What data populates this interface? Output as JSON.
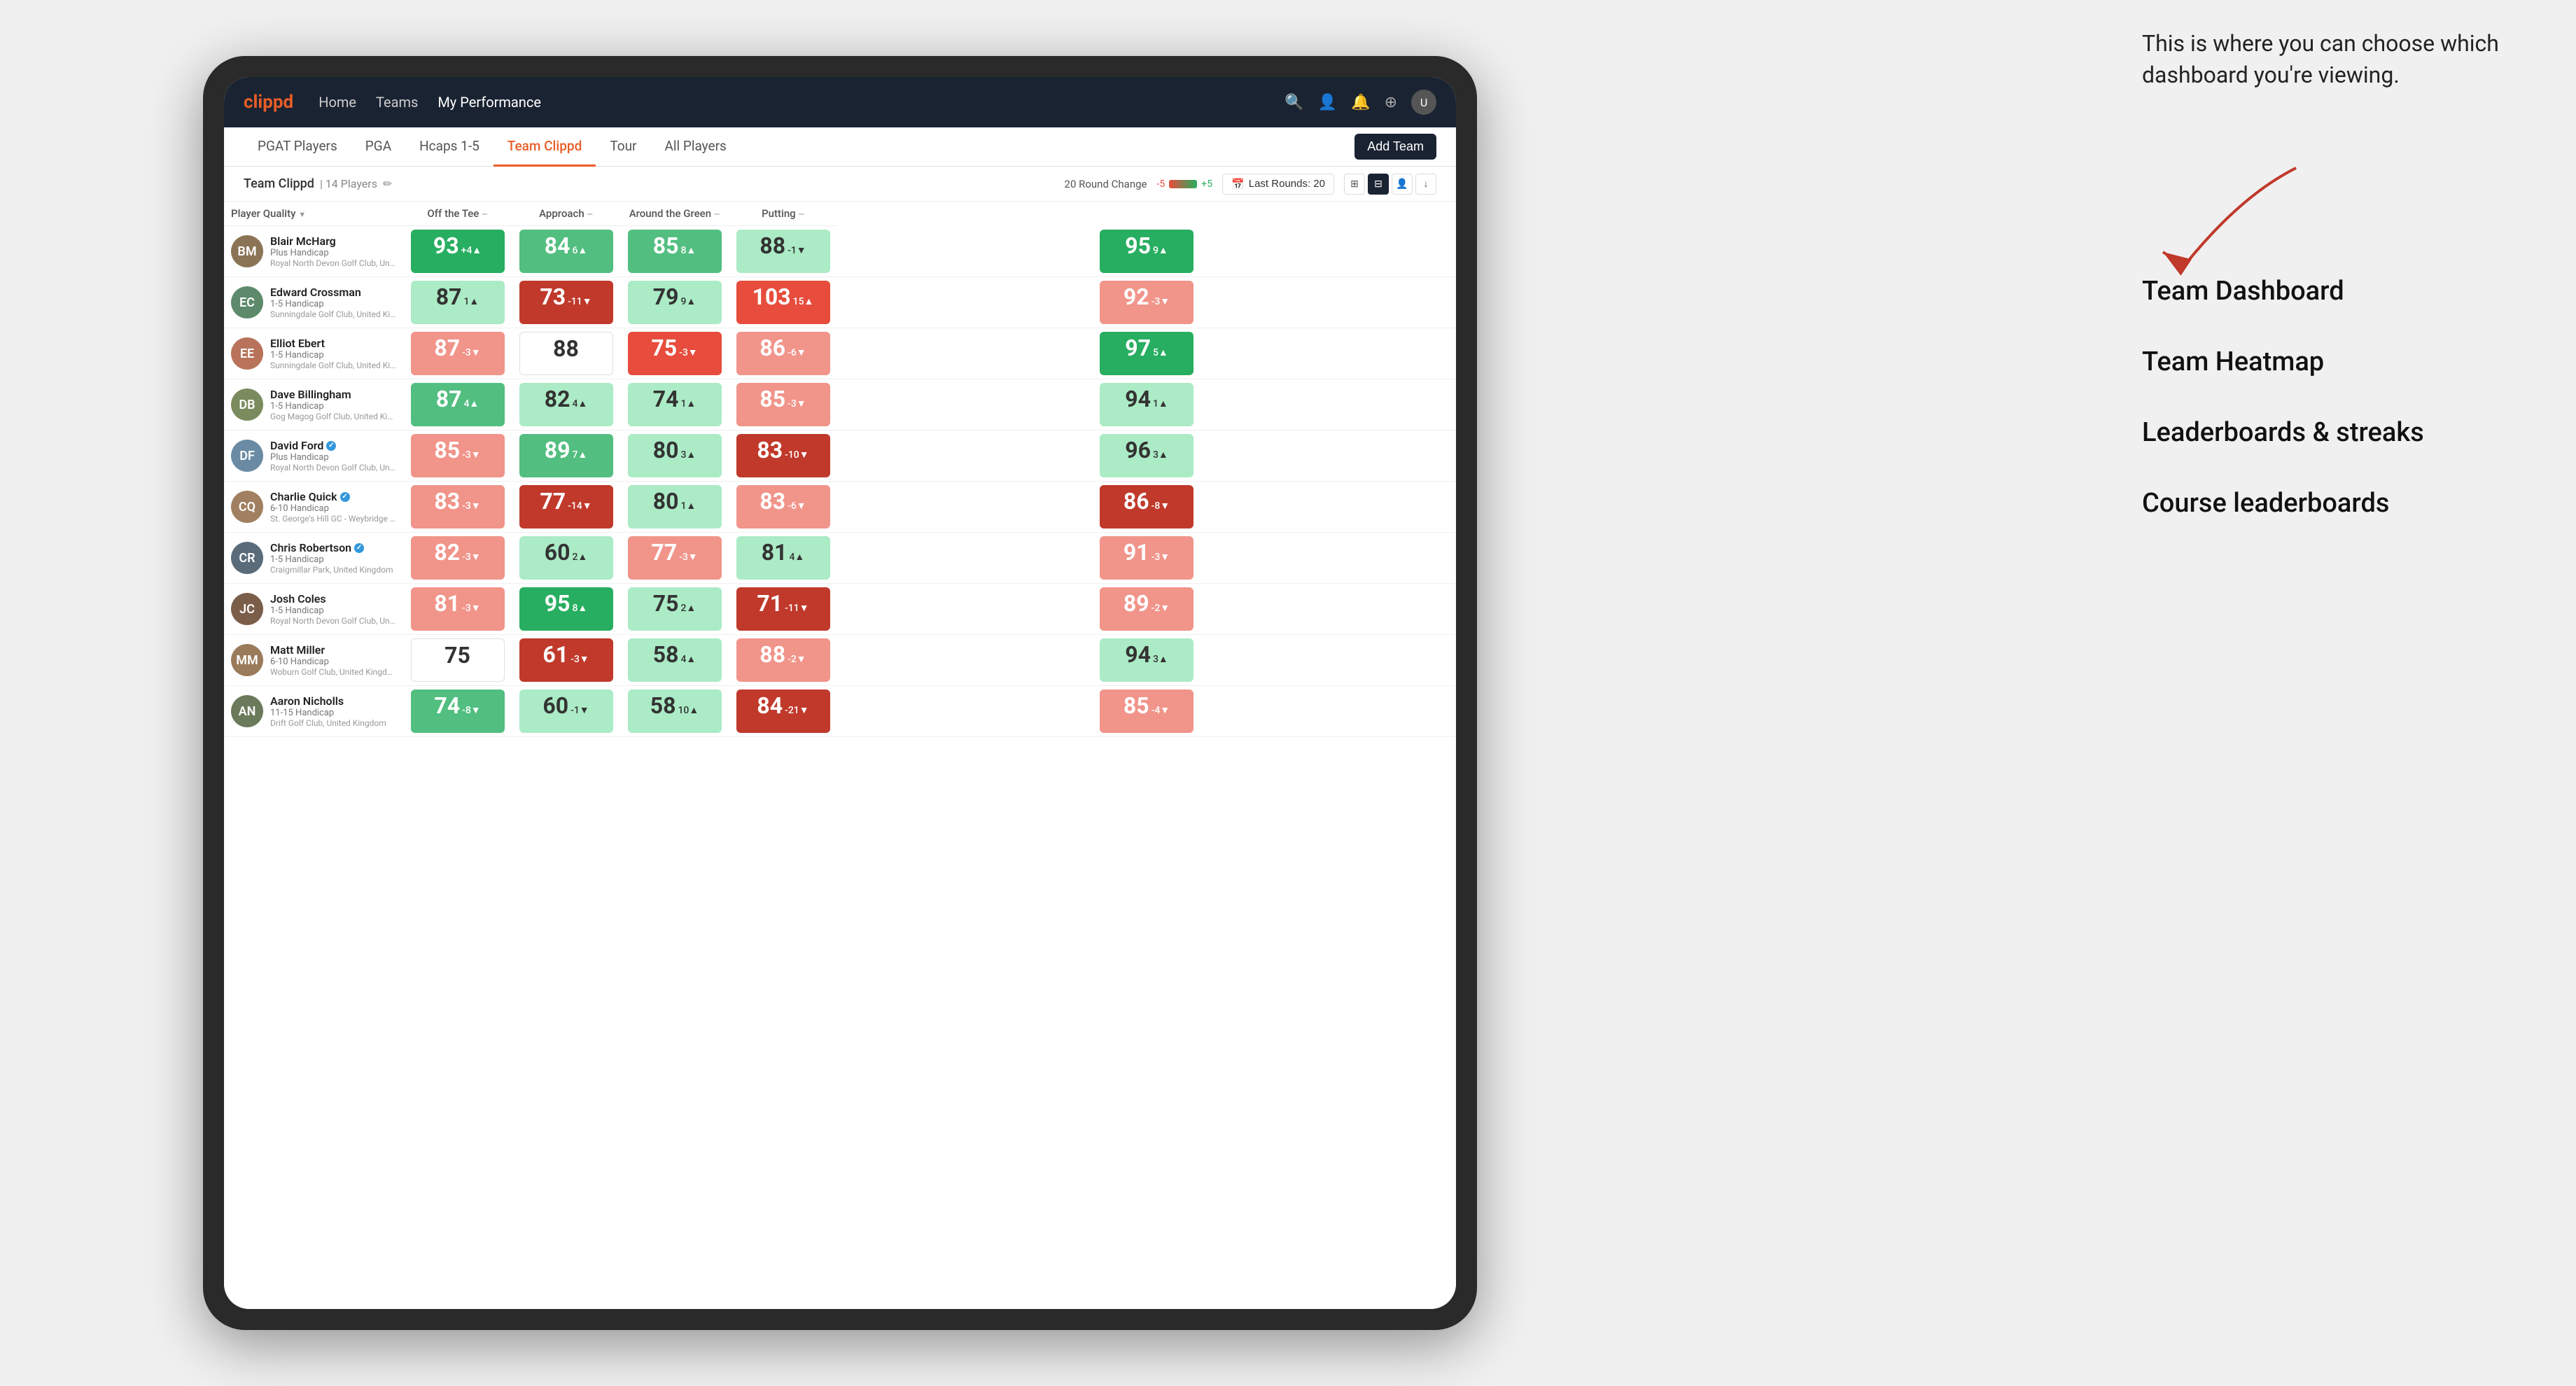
{
  "annotation": {
    "intro": "This is where you can choose which dashboard you're viewing.",
    "items": [
      "Team Dashboard",
      "Team Heatmap",
      "Leaderboards & streaks",
      "Course leaderboards"
    ]
  },
  "navbar": {
    "logo": "clippd",
    "items": [
      {
        "label": "Home",
        "active": false
      },
      {
        "label": "Teams",
        "active": false
      },
      {
        "label": "My Performance",
        "active": true
      }
    ],
    "icons": [
      "🔍",
      "👤",
      "🔔",
      "⊕"
    ]
  },
  "sub_nav": {
    "tabs": [
      {
        "label": "PGAT Players",
        "active": false
      },
      {
        "label": "PGA",
        "active": false
      },
      {
        "label": "Hcaps 1-5",
        "active": false
      },
      {
        "label": "Team Clippd",
        "active": true
      },
      {
        "label": "Tour",
        "active": false
      },
      {
        "label": "All Players",
        "active": false
      }
    ],
    "add_team_label": "Add Team"
  },
  "team_header": {
    "name": "Team Clippd",
    "player_count": "14 Players",
    "round_change_label": "20 Round Change",
    "change_neg": "-5",
    "change_pos": "+5",
    "last_rounds_label": "Last Rounds: 20"
  },
  "table": {
    "columns": [
      {
        "label": "Player Quality",
        "key": "quality"
      },
      {
        "label": "Off the Tee",
        "key": "tee"
      },
      {
        "label": "Approach",
        "key": "approach"
      },
      {
        "label": "Around the Green",
        "key": "green"
      },
      {
        "label": "Putting",
        "key": "putting"
      }
    ],
    "players": [
      {
        "name": "Blair McHarg",
        "handicap": "Plus Handicap",
        "club": "Royal North Devon Golf Club, United Kingdom",
        "avatar_color": "#8B7355",
        "avatar_initials": "BM",
        "verified": false,
        "quality": {
          "score": 93,
          "delta": "+4",
          "dir": "up",
          "color": "green-dark"
        },
        "tee": {
          "score": 84,
          "delta": "6",
          "dir": "up",
          "color": "green-med"
        },
        "approach": {
          "score": 85,
          "delta": "8",
          "dir": "up",
          "color": "green-med"
        },
        "green": {
          "score": 88,
          "delta": "-1",
          "dir": "down",
          "color": "green-light"
        },
        "putting": {
          "score": 95,
          "delta": "9",
          "dir": "up",
          "color": "green-dark"
        }
      },
      {
        "name": "Edward Crossman",
        "handicap": "1-5 Handicap",
        "club": "Sunningdale Golf Club, United Kingdom",
        "avatar_color": "#5D8A6B",
        "avatar_initials": "EC",
        "verified": false,
        "quality": {
          "score": 87,
          "delta": "1",
          "dir": "up",
          "color": "green-light"
        },
        "tee": {
          "score": 73,
          "delta": "-11",
          "dir": "down",
          "color": "red-dark"
        },
        "approach": {
          "score": 79,
          "delta": "9",
          "dir": "up",
          "color": "green-light"
        },
        "green": {
          "score": 103,
          "delta": "15",
          "dir": "up",
          "color": "red-med"
        },
        "putting": {
          "score": 92,
          "delta": "-3",
          "dir": "down",
          "color": "red-light"
        }
      },
      {
        "name": "Elliot Ebert",
        "handicap": "1-5 Handicap",
        "club": "Sunningdale Golf Club, United Kingdom",
        "avatar_color": "#B8735A",
        "avatar_initials": "EE",
        "verified": false,
        "quality": {
          "score": 87,
          "delta": "-3",
          "dir": "down",
          "color": "red-light"
        },
        "tee": {
          "score": 88,
          "delta": "",
          "dir": "none",
          "color": "white"
        },
        "approach": {
          "score": 75,
          "delta": "-3",
          "dir": "down",
          "color": "red-med"
        },
        "green": {
          "score": 86,
          "delta": "-6",
          "dir": "down",
          "color": "red-light"
        },
        "putting": {
          "score": 97,
          "delta": "5",
          "dir": "up",
          "color": "green-dark"
        }
      },
      {
        "name": "Dave Billingham",
        "handicap": "1-5 Handicap",
        "club": "Gog Magog Golf Club, United Kingdom",
        "avatar_color": "#7A8B5D",
        "avatar_initials": "DB",
        "verified": false,
        "quality": {
          "score": 87,
          "delta": "4",
          "dir": "up",
          "color": "green-med"
        },
        "tee": {
          "score": 82,
          "delta": "4",
          "dir": "up",
          "color": "green-light"
        },
        "approach": {
          "score": 74,
          "delta": "1",
          "dir": "up",
          "color": "green-light"
        },
        "green": {
          "score": 85,
          "delta": "-3",
          "dir": "down",
          "color": "red-light"
        },
        "putting": {
          "score": 94,
          "delta": "1",
          "dir": "up",
          "color": "green-light"
        }
      },
      {
        "name": "David Ford",
        "handicap": "Plus Handicap",
        "club": "Royal North Devon Golf Club, United Kingdom",
        "avatar_color": "#6B8BA4",
        "avatar_initials": "DF",
        "verified": true,
        "quality": {
          "score": 85,
          "delta": "-3",
          "dir": "down",
          "color": "red-light"
        },
        "tee": {
          "score": 89,
          "delta": "7",
          "dir": "up",
          "color": "green-med"
        },
        "approach": {
          "score": 80,
          "delta": "3",
          "dir": "up",
          "color": "green-light"
        },
        "green": {
          "score": 83,
          "delta": "-10",
          "dir": "down",
          "color": "red-dark"
        },
        "putting": {
          "score": 96,
          "delta": "3",
          "dir": "up",
          "color": "green-light"
        }
      },
      {
        "name": "Charlie Quick",
        "handicap": "6-10 Handicap",
        "club": "St. George's Hill GC - Weybridge - Surrey, Uni...",
        "avatar_color": "#A08060",
        "avatar_initials": "CQ",
        "verified": true,
        "quality": {
          "score": 83,
          "delta": "-3",
          "dir": "down",
          "color": "red-light"
        },
        "tee": {
          "score": 77,
          "delta": "-14",
          "dir": "down",
          "color": "red-dark"
        },
        "approach": {
          "score": 80,
          "delta": "1",
          "dir": "up",
          "color": "green-light"
        },
        "green": {
          "score": 83,
          "delta": "-6",
          "dir": "down",
          "color": "red-light"
        },
        "putting": {
          "score": 86,
          "delta": "-8",
          "dir": "down",
          "color": "red-dark"
        }
      },
      {
        "name": "Chris Robertson",
        "handicap": "1-5 Handicap",
        "club": "Craigmillar Park, United Kingdom",
        "avatar_color": "#5A6B7A",
        "avatar_initials": "CR",
        "verified": true,
        "quality": {
          "score": 82,
          "delta": "-3",
          "dir": "down",
          "color": "red-light"
        },
        "tee": {
          "score": 60,
          "delta": "2",
          "dir": "up",
          "color": "green-light"
        },
        "approach": {
          "score": 77,
          "delta": "-3",
          "dir": "down",
          "color": "red-light"
        },
        "green": {
          "score": 81,
          "delta": "4",
          "dir": "up",
          "color": "green-light"
        },
        "putting": {
          "score": 91,
          "delta": "-3",
          "dir": "down",
          "color": "red-light"
        }
      },
      {
        "name": "Josh Coles",
        "handicap": "1-5 Handicap",
        "club": "Royal North Devon Golf Club, United Kingdom",
        "avatar_color": "#7B5E4A",
        "avatar_initials": "JC",
        "verified": false,
        "quality": {
          "score": 81,
          "delta": "-3",
          "dir": "down",
          "color": "red-light"
        },
        "tee": {
          "score": 95,
          "delta": "8",
          "dir": "up",
          "color": "green-dark"
        },
        "approach": {
          "score": 75,
          "delta": "2",
          "dir": "up",
          "color": "green-light"
        },
        "green": {
          "score": 71,
          "delta": "-11",
          "dir": "down",
          "color": "red-dark"
        },
        "putting": {
          "score": 89,
          "delta": "-2",
          "dir": "down",
          "color": "red-light"
        }
      },
      {
        "name": "Matt Miller",
        "handicap": "6-10 Handicap",
        "club": "Woburn Golf Club, United Kingdom",
        "avatar_color": "#9A7B5A",
        "avatar_initials": "MM",
        "verified": false,
        "quality": {
          "score": 75,
          "delta": "",
          "dir": "none",
          "color": "white"
        },
        "tee": {
          "score": 61,
          "delta": "-3",
          "dir": "down",
          "color": "red-dark"
        },
        "approach": {
          "score": 58,
          "delta": "4",
          "dir": "up",
          "color": "green-light"
        },
        "green": {
          "score": 88,
          "delta": "-2",
          "dir": "down",
          "color": "red-light"
        },
        "putting": {
          "score": 94,
          "delta": "3",
          "dir": "up",
          "color": "green-light"
        }
      },
      {
        "name": "Aaron Nicholls",
        "handicap": "11-15 Handicap",
        "club": "Drift Golf Club, United Kingdom",
        "avatar_color": "#6B7A5A",
        "avatar_initials": "AN",
        "verified": false,
        "quality": {
          "score": 74,
          "delta": "-8",
          "dir": "down",
          "color": "green-med"
        },
        "tee": {
          "score": 60,
          "delta": "-1",
          "dir": "down",
          "color": "green-light"
        },
        "approach": {
          "score": 58,
          "delta": "10",
          "dir": "up",
          "color": "green-light"
        },
        "green": {
          "score": 84,
          "delta": "-21",
          "dir": "down",
          "color": "red-dark"
        },
        "putting": {
          "score": 85,
          "delta": "-4",
          "dir": "down",
          "color": "red-light"
        }
      }
    ]
  }
}
